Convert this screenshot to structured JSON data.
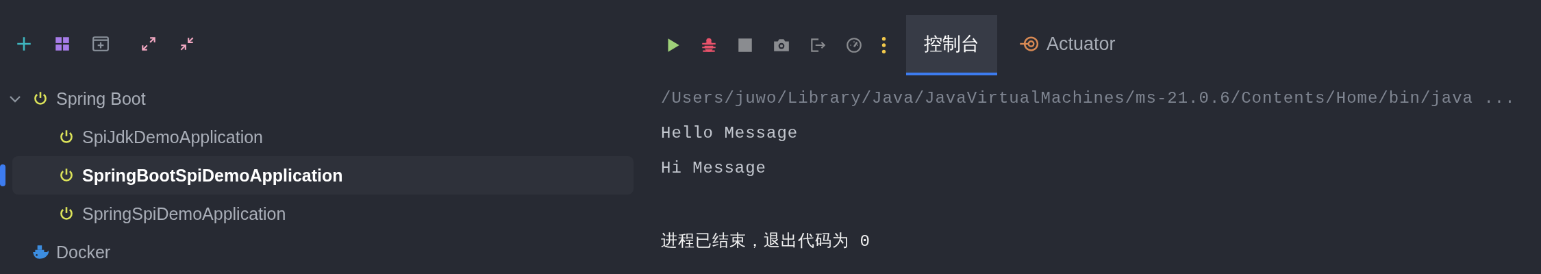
{
  "left_toolbar": [
    {
      "kind": "add"
    },
    {
      "kind": "grid"
    },
    {
      "kind": "new-tab"
    },
    {
      "kind": "expand"
    },
    {
      "kind": "collapse"
    }
  ],
  "tree": [
    {
      "label": "Spring Boot",
      "kind": "spring",
      "expanded": true,
      "selected": false,
      "children": [
        {
          "label": "SpiJdkDemoApplication",
          "kind": "spring",
          "selected": false
        },
        {
          "label": "SpringBootSpiDemoApplication",
          "kind": "spring",
          "selected": true
        },
        {
          "label": "SpringSpiDemoApplication",
          "kind": "spring",
          "selected": false
        }
      ]
    },
    {
      "label": "Docker",
      "kind": "docker",
      "selected": false
    }
  ],
  "run_toolbar": [
    {
      "kind": "run"
    },
    {
      "kind": "debug"
    },
    {
      "kind": "stop"
    },
    {
      "kind": "camera"
    },
    {
      "kind": "exit"
    },
    {
      "kind": "gauge"
    },
    {
      "kind": "more"
    }
  ],
  "tabs": [
    {
      "label": "控制台",
      "selected": true
    },
    {
      "label": "Actuator",
      "selected": false,
      "kind": "actuator"
    }
  ],
  "console": [
    {
      "kind": "command",
      "text": "/Users/juwo/Library/Java/JavaVirtualMachines/ms-21.0.6/Contents/Home/bin/java ..."
    },
    {
      "kind": "output",
      "text": "Hello Message"
    },
    {
      "kind": "output",
      "text": "Hi Message"
    },
    {
      "kind": "status",
      "text": "进程已结束，退出代码为 0"
    }
  ]
}
